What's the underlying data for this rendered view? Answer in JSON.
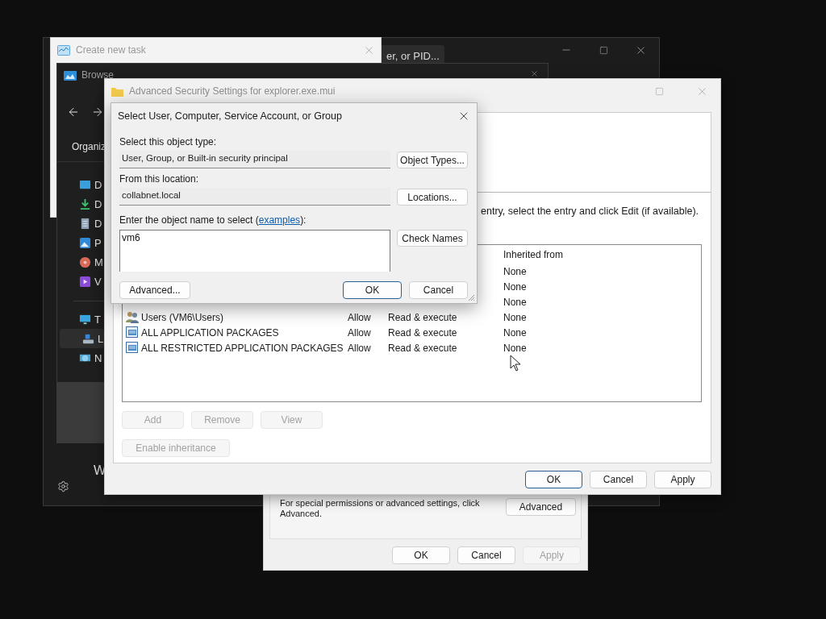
{
  "task_manager": {
    "search_text": "er, or PID...",
    "section_heading": "W"
  },
  "create_task_window": {
    "title": "Create new task"
  },
  "browse_window": {
    "title": "Browse",
    "toolbar_label": "Organiz",
    "nav_items": [
      {
        "label": "D",
        "kind": "desktop",
        "selected": false
      },
      {
        "label": "D",
        "kind": "download",
        "selected": false
      },
      {
        "label": "D",
        "kind": "document",
        "selected": false
      },
      {
        "label": "P",
        "kind": "pictures",
        "selected": false
      },
      {
        "label": "M",
        "kind": "music",
        "selected": false
      },
      {
        "label": "V",
        "kind": "videos",
        "selected": false
      }
    ],
    "nav_tree": [
      {
        "label": "T",
        "kind": "computer",
        "selected": false,
        "children": [
          {
            "label": "L",
            "kind": "drive",
            "selected": true
          }
        ]
      },
      {
        "label": "N",
        "kind": "network",
        "selected": false
      }
    ]
  },
  "permissions_window": {
    "note": "For special permissions or advanced settings, click Advanced.",
    "advanced_button": "Advanced",
    "buttons": [
      {
        "label": "OK",
        "disabled": false
      },
      {
        "label": "Cancel",
        "disabled": false
      },
      {
        "label": "Apply",
        "disabled": true
      }
    ]
  },
  "advanced_security": {
    "title": "Advanced Security Settings for explorer.exe.mui",
    "hint": "entry, select the entry and click Edit (if available).",
    "table": {
      "inherited_header": "Inherited from",
      "rows": [
        {
          "inherited": "None"
        },
        {
          "inherited": "None"
        },
        {
          "inherited": "None"
        },
        {
          "kind": "users",
          "principal": "Users (VM6\\Users)",
          "type": "Allow",
          "access": "Read & execute",
          "inherited": "None"
        },
        {
          "kind": "package",
          "principal": "ALL APPLICATION PACKAGES",
          "type": "Allow",
          "access": "Read & execute",
          "inherited": "None"
        },
        {
          "kind": "package",
          "principal": "ALL RESTRICTED APPLICATION PACKAGES",
          "type": "Allow",
          "access": "Read & execute",
          "inherited": "None"
        }
      ]
    },
    "entry_buttons": [
      {
        "label": "Add",
        "disabled": true
      },
      {
        "label": "Remove",
        "disabled": true
      },
      {
        "label": "View",
        "disabled": true
      }
    ],
    "inheritance_button": {
      "label": "Enable inheritance",
      "disabled": true
    },
    "buttons": [
      {
        "label": "OK",
        "default": true
      },
      {
        "label": "Cancel",
        "default": false
      },
      {
        "label": "Apply",
        "default": false
      }
    ]
  },
  "select_dialog": {
    "title": "Select User, Computer, Service Account, or Group",
    "object_type_label": "Select this object type:",
    "object_type": "User, Group, or Built-in security principal",
    "object_types_button": "Object Types...",
    "location_label": "From this location:",
    "location": "collabnet.local",
    "locations_button": "Locations...",
    "name_label_before": "Enter the object name to select (",
    "name_label_link": "examples",
    "name_label_after": "):",
    "name_value": "vm6",
    "check_names_button": "Check Names",
    "advanced_button": "Advanced...",
    "buttons": [
      {
        "label": "OK",
        "default": true
      },
      {
        "label": "Cancel",
        "default": false
      }
    ]
  }
}
